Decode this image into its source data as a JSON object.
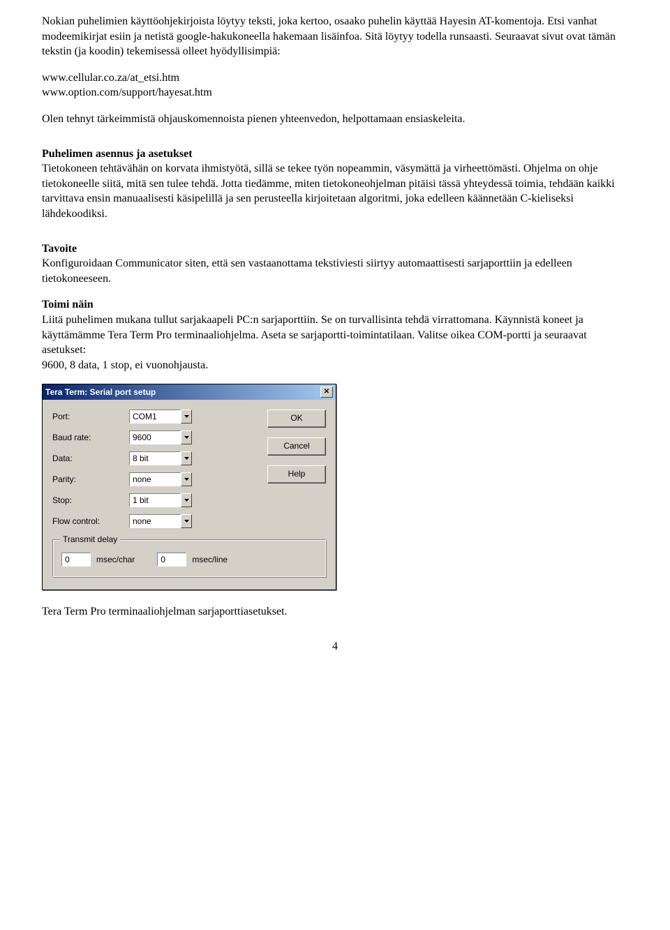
{
  "para1": "Nokian puhelimien käyttöohjekirjoista löytyy teksti, joka kertoo, osaako puhelin käyttää Hayesin AT-komentoja. Etsi vanhat modeemikirjat esiin ja netistä google-hakukoneella hakemaan lisäinfoa. Sitä löytyy todella runsaasti. Seuraavat sivut ovat tämän tekstin (ja koodin) tekemisessä olleet hyödyllisimpiä:",
  "link1": "www.cellular.co.za/at_etsi.htm",
  "link2": "www.option.com/support/hayesat.htm",
  "para2": "Olen tehnyt tärkeimmistä ohjauskomennoista pienen yhteenvedon, helpottamaan ensiaskeleita.",
  "h_asennus": "Puhelimen asennus ja asetukset",
  "para3": "Tietokoneen tehtävähän on korvata ihmistyötä, sillä se tekee työn nopeammin, väsymättä ja virheettömästi. Ohjelma on ohje tietokoneelle siitä, mitä sen tulee tehdä. Jotta tiedämme, miten tietokoneohjelman pitäisi tässä yhteydessä toimia, tehdään kaikki tarvittava ensin manuaalisesti käsipelillä ja sen perusteella kirjoitetaan algoritmi, joka edelleen käännetään C-kieliseksi lähdekoodiksi.",
  "h_tavoite": "Tavoite",
  "para4": "Konfiguroidaan Communicator siten, että sen vastaanottama tekstiviesti siirtyy automaattisesti sarjaporttiin ja edelleen tietokoneeseen.",
  "h_toimi": "Toimi näin",
  "para5": "Liitä puhelimen mukana tullut sarjakaapeli PC:n sarjaporttiin. Se on turvallisinta tehdä virrattomana. Käynnistä  koneet ja käyttämämme Tera Term Pro terminaaliohjelma. Aseta se sarjaportti-toimintatilaan. Valitse oikea COM-portti ja seuraavat asetukset:",
  "para5b": "9600, 8 data, 1 stop, ei vuonohjausta.",
  "dialog": {
    "title": "Tera Term: Serial port setup",
    "labels": {
      "port": "Port:",
      "baud": "Baud rate:",
      "data": "Data:",
      "parity": "Parity:",
      "stop": "Stop:",
      "flow": "Flow control:"
    },
    "values": {
      "port": "COM1",
      "baud": "9600",
      "data": "8 bit",
      "parity": "none",
      "stop": "1 bit",
      "flow": "none"
    },
    "buttons": {
      "ok": "OK",
      "cancel": "Cancel",
      "help": "Help"
    },
    "group": {
      "legend": "Transmit delay",
      "val1": "0",
      "unit1": "msec/char",
      "val2": "0",
      "unit2": "msec/line"
    },
    "close_x": "✕"
  },
  "caption": "Tera Term Pro terminaaliohjelman sarjaporttiasetukset.",
  "pagenum": "4"
}
